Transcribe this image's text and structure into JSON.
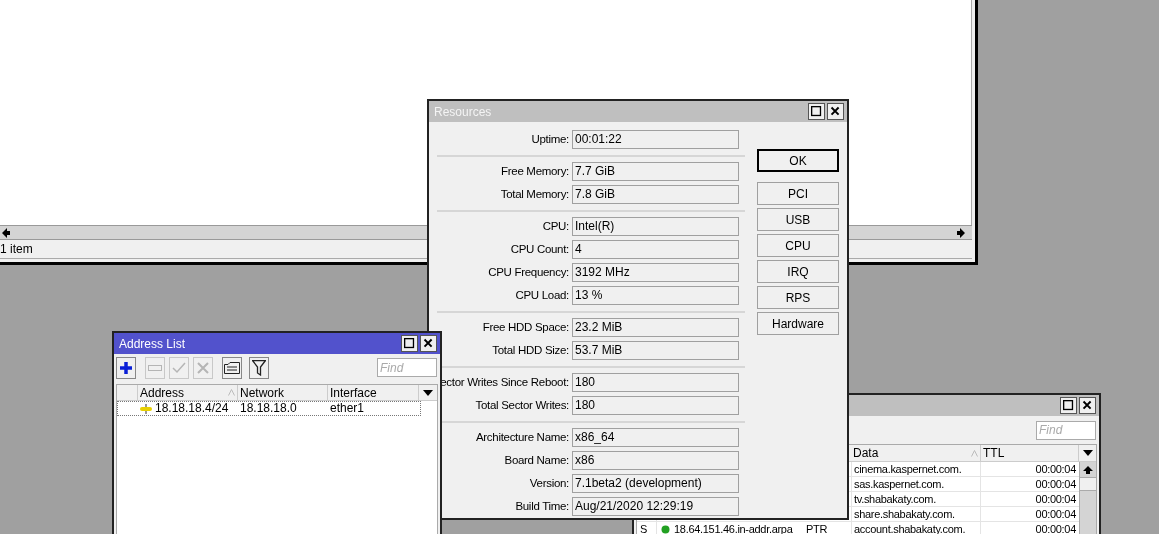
{
  "main_window": {
    "active": false,
    "status": "1 item"
  },
  "resources": {
    "title": "Resources",
    "active": false,
    "groups": [
      [
        {
          "label": "Uptime:",
          "value": "00:01:22"
        }
      ],
      [
        {
          "label": "Free Memory:",
          "value": "7.7 GiB"
        },
        {
          "label": "Total Memory:",
          "value": "7.8 GiB"
        }
      ],
      [
        {
          "label": "CPU:",
          "value": "Intel(R)"
        },
        {
          "label": "CPU Count:",
          "value": "4"
        },
        {
          "label": "CPU Frequency:",
          "value": "3192 MHz"
        },
        {
          "label": "CPU Load:",
          "value": "13 %"
        }
      ],
      [
        {
          "label": "Free HDD Space:",
          "value": "23.2 MiB"
        },
        {
          "label": "Total HDD Size:",
          "value": "53.7 MiB"
        }
      ],
      [
        {
          "label": "ector Writes Since Reboot:",
          "value": "180"
        },
        {
          "label": "Total Sector Writes:",
          "value": "180"
        }
      ],
      [
        {
          "label": "Architecture Name:",
          "value": "x86_64"
        },
        {
          "label": "Board Name:",
          "value": "x86"
        },
        {
          "label": "Version:",
          "value": "7.1beta2 (development)"
        },
        {
          "label": "Build Time:",
          "value": "Aug/21/2020 12:29:19"
        }
      ]
    ],
    "buttons": [
      {
        "label": "OK",
        "default": true
      },
      {
        "label": "PCI",
        "default": false
      },
      {
        "label": "USB",
        "default": false
      },
      {
        "label": "CPU",
        "default": false
      },
      {
        "label": "IRQ",
        "default": false
      },
      {
        "label": "RPS",
        "default": false
      },
      {
        "label": "Hardware",
        "default": false
      }
    ]
  },
  "address_list": {
    "title": "Address List",
    "active": true,
    "toolbar": [
      {
        "kind": "add",
        "disabled": false
      },
      {
        "kind": "remove",
        "disabled": true
      },
      {
        "kind": "enable",
        "disabled": true
      },
      {
        "kind": "disable",
        "disabled": true
      },
      {
        "kind": "comment",
        "disabled": false
      },
      {
        "kind": "filter",
        "disabled": false
      }
    ],
    "find_placeholder": "Find",
    "columns": [
      "Address",
      "Network",
      "Interface"
    ],
    "rows": [
      {
        "address": "18.18.18.4/24",
        "network": "18.18.18.0",
        "interface": "ether1"
      }
    ]
  },
  "dns_window": {
    "active": false,
    "find_placeholder": "Find",
    "columns": [
      "Data",
      "TTL"
    ],
    "rows": [
      {
        "data": "cinema.kaspernet.com.",
        "ttl": "00:00:04"
      },
      {
        "data": "sas.kaspernet.com.",
        "ttl": "00:00:04"
      },
      {
        "data": "tv.shabakaty.com.",
        "ttl": "00:00:04"
      },
      {
        "data": "share.shabakaty.com.",
        "ttl": "00:00:04"
      },
      {
        "flag": "S",
        "name": "18.64.151.46.in-addr.arpa",
        "type": "PTR",
        "data": "account.shabakaty.com.",
        "ttl": "00:00:04"
      }
    ]
  }
}
